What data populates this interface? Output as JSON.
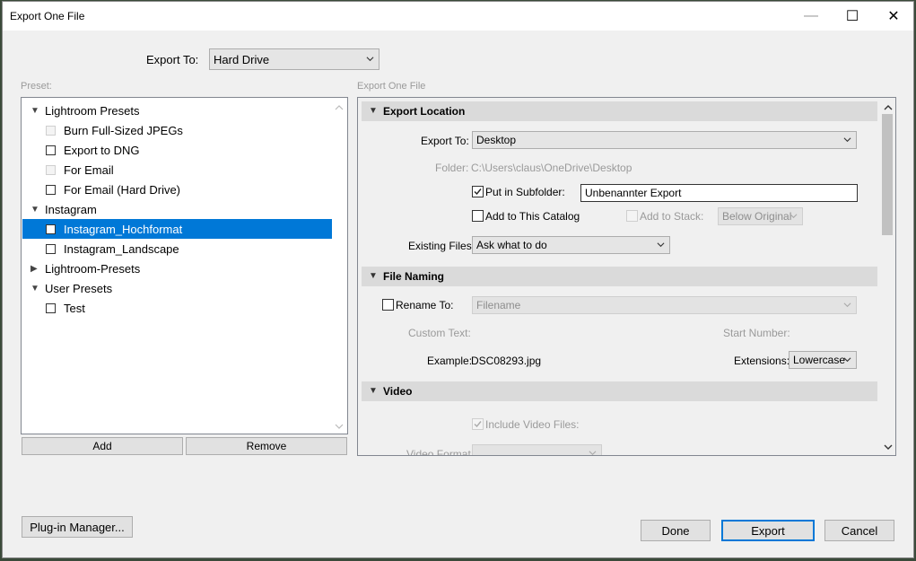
{
  "window": {
    "title": "Export One File",
    "minimize": "—",
    "maximize": "☐",
    "close": "✕"
  },
  "export_to": {
    "label": "Export To:",
    "value": "Hard Drive"
  },
  "preset": {
    "label": "Preset:",
    "groups": [
      {
        "name": "Lightroom Presets",
        "items": [
          "Burn Full-Sized JPEGs",
          "Export to DNG",
          "For Email",
          "For Email (Hard Drive)"
        ]
      },
      {
        "name": "Instagram",
        "items": [
          "Instagram_Hochformat",
          "Instagram_Landscape"
        ]
      },
      {
        "name": "Lightroom-Presets",
        "items": []
      },
      {
        "name": "User Presets",
        "items": [
          "Test"
        ]
      }
    ],
    "add": "Add",
    "remove": "Remove"
  },
  "right": {
    "header": "Export One File",
    "export_location": {
      "title": "Export Location",
      "export_to_label": "Export To:",
      "export_to_value": "Desktop",
      "folder_label": "Folder:",
      "folder_value": "C:\\Users\\claus\\OneDrive\\Desktop",
      "subfolder_label": "Put in Subfolder:",
      "subfolder_value": "Unbenannter Export",
      "add_catalog_label": "Add to This Catalog",
      "add_stack_label": "Add to Stack:",
      "stack_value": "Below Original",
      "existing_label": "Existing Files:",
      "existing_value": "Ask what to do"
    },
    "file_naming": {
      "title": "File Naming",
      "rename_label": "Rename To:",
      "rename_value": "Filename",
      "custom_text_label": "Custom Text:",
      "start_number_label": "Start Number:",
      "example_label": "Example:",
      "example_value": "DSC08293.jpg",
      "extensions_label": "Extensions:",
      "extensions_value": "Lowercase"
    },
    "video": {
      "title": "Video",
      "include_label": "Include Video Files:",
      "format_label": "Video Format:"
    }
  },
  "footer": {
    "plugin": "Plug-in Manager...",
    "done": "Done",
    "export": "Export",
    "cancel": "Cancel"
  }
}
